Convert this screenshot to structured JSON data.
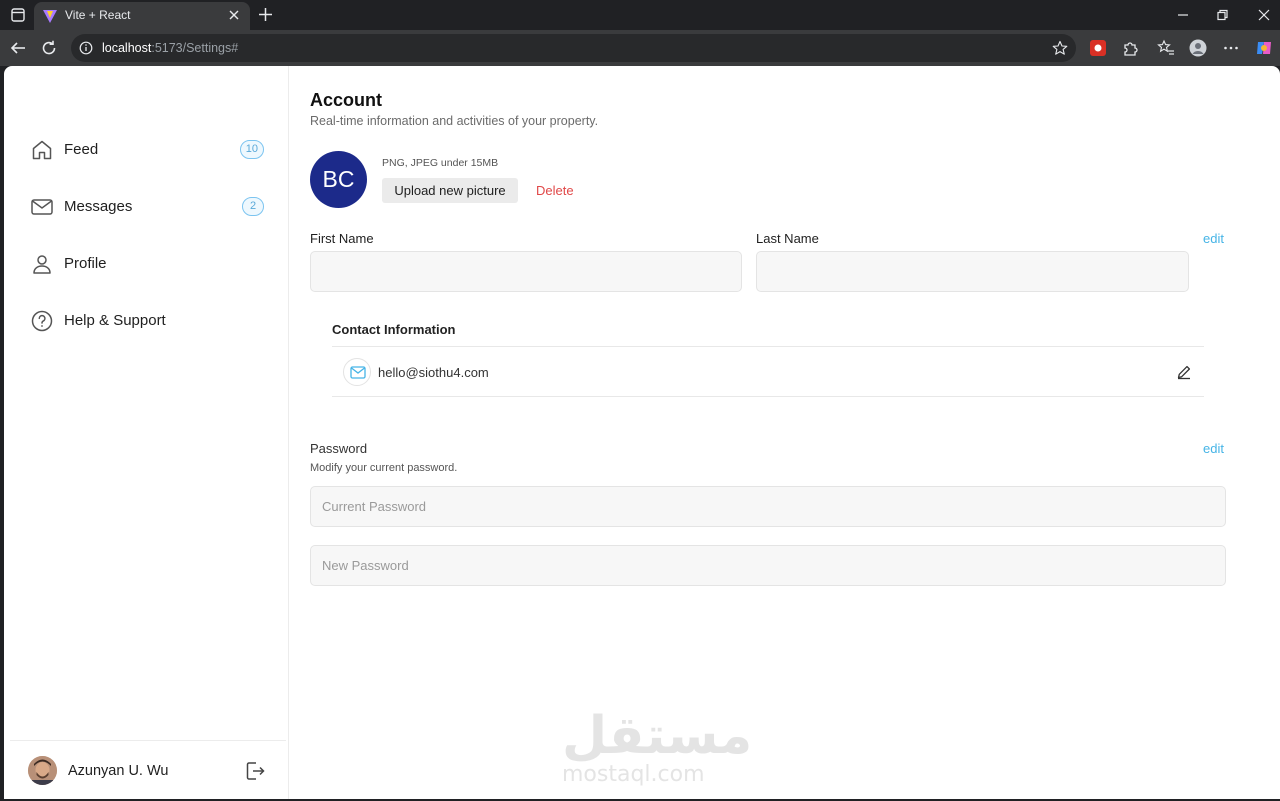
{
  "browser": {
    "tab_title": "Vite + React",
    "url_host": "localhost",
    "url_rest": ":5173/Settings#"
  },
  "sidebar": {
    "items": [
      {
        "label": "Feed",
        "icon": "home-icon",
        "badge": "10"
      },
      {
        "label": "Messages",
        "icon": "mail-icon",
        "badge": "2"
      },
      {
        "label": "Profile",
        "icon": "user-icon"
      },
      {
        "label": "Help & Support",
        "icon": "help-icon"
      }
    ],
    "user": {
      "name": "Azunyan U. Wu"
    }
  },
  "account": {
    "title": "Account",
    "subtitle": "Real-time information and activities of your property.",
    "avatar_initials": "BC",
    "file_hint": "PNG, JPEG under 15MB",
    "upload_label": "Upload new picture",
    "delete_label": "Delete",
    "first_name_label": "First Name",
    "last_name_label": "Last Name",
    "edit_label": "edit",
    "first_name_value": "",
    "last_name_value": ""
  },
  "contact": {
    "title": "Contact Information",
    "email": "hello@siothu4.com"
  },
  "password": {
    "title": "Password",
    "subtitle": "Modify your current password.",
    "edit_label": "edit",
    "current_placeholder": "Current Password",
    "new_placeholder": "New Password"
  },
  "watermark": {
    "arabic": "مستقل",
    "latin": "mostaql.com"
  },
  "colors": {
    "accent": "#46b4e6",
    "danger": "#e04848",
    "avatar_bg": "#1c2a8a"
  }
}
